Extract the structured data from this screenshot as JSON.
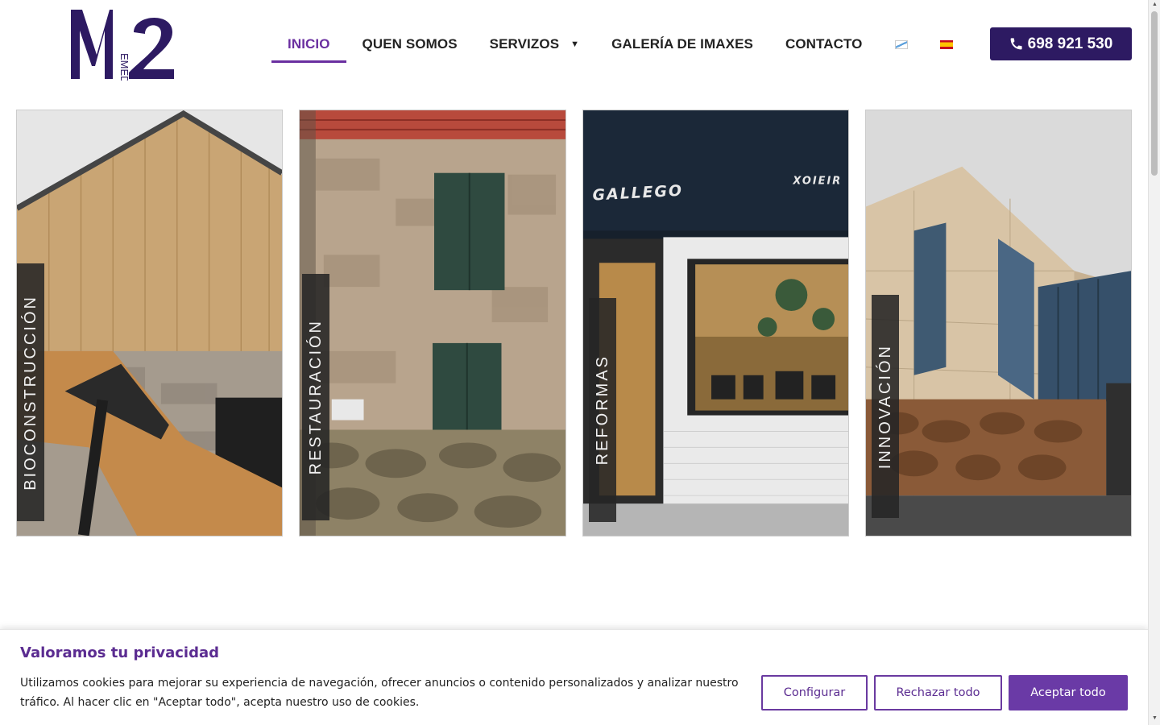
{
  "logo": {
    "letters": "M2",
    "subtitle": "EMEDOUS"
  },
  "nav": {
    "items": [
      {
        "label": "INICIO",
        "active": true
      },
      {
        "label": "QUEN SOMOS"
      },
      {
        "label": "SERVIZOS",
        "has_dropdown": true
      },
      {
        "label": "GALERÍA DE IMAXES"
      },
      {
        "label": "CONTACTO"
      }
    ],
    "languages": [
      {
        "code": "gl",
        "icon": "galician-flag-icon"
      },
      {
        "code": "es",
        "icon": "spanish-flag-icon"
      }
    ]
  },
  "phone": {
    "number": "698 921 530",
    "icon": "phone-icon"
  },
  "panels": [
    {
      "label": "BIOCONSTRUCCIÓN"
    },
    {
      "label": "RESTAURACIÓN"
    },
    {
      "label": "REFORMAS",
      "sign_text": "GALLEGO",
      "sign_text_2": "XOIEIR"
    },
    {
      "label": "INNOVACIÓN"
    }
  ],
  "cookie_banner": {
    "title": "Valoramos tu privacidad",
    "text": "Utilizamos cookies para mejorar su experiencia de navegación, ofrecer anuncios o contenido personalizados y analizar nuestro tráfico. Al hacer clic en \"Aceptar todo\", acepta nuestro uso de cookies.",
    "configure_label": "Configurar",
    "reject_label": "Rechazar todo",
    "accept_label": "Aceptar todo"
  },
  "colors": {
    "brand": "#2d1a62",
    "accent": "#6a3aa6",
    "active_nav": "#6a2fa0"
  }
}
